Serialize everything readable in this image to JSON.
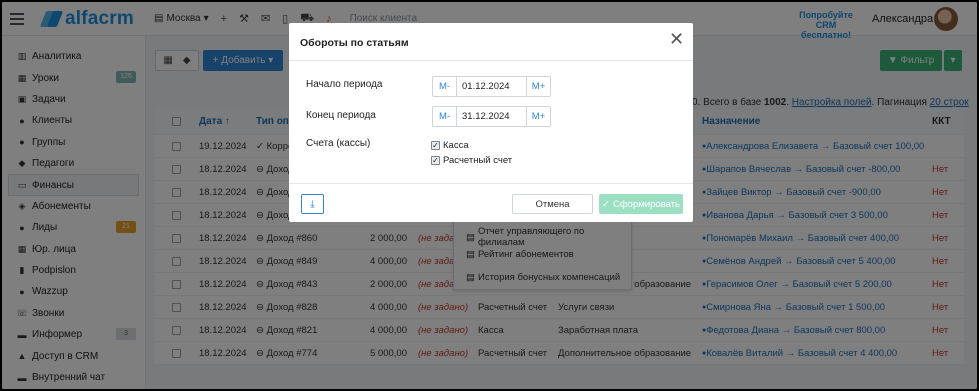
{
  "header": {
    "logo_text": "alfacrm",
    "branch": "Москва",
    "search_placeholder": "Поиск клиента",
    "promo_line1": "Попробуйте",
    "promo_line2": "CRM бесплатно!",
    "user_name": "Александра"
  },
  "sidebar": {
    "items": [
      {
        "label": "Аналитика",
        "icon": "chart-icon"
      },
      {
        "label": "Уроки",
        "icon": "calendar-icon",
        "badge": "126"
      },
      {
        "label": "Задачи",
        "icon": "tasks-icon"
      },
      {
        "label": "Клиенты",
        "icon": "user-icon"
      },
      {
        "label": "Группы",
        "icon": "users-icon"
      },
      {
        "label": "Педагоги",
        "icon": "graduation-cap-icon"
      },
      {
        "label": "Финансы",
        "icon": "money-icon"
      },
      {
        "label": "Абонементы",
        "icon": "tag-icon"
      },
      {
        "label": "Лиды",
        "icon": "user-plus-icon",
        "badge": "21"
      },
      {
        "label": "Юр. лица",
        "icon": "building-icon"
      },
      {
        "label": "Podpislon",
        "icon": "document-icon"
      },
      {
        "label": "Wazzup",
        "icon": "chat-icon"
      },
      {
        "label": "Звонки",
        "icon": "phone-icon"
      },
      {
        "label": "Информер",
        "icon": "monitor-icon",
        "badge": "3"
      },
      {
        "label": "Доступ в CRM",
        "icon": "lock-icon"
      },
      {
        "label": "Внутренний чат",
        "icon": "message-icon"
      }
    ]
  },
  "toolbar": {
    "add_label": "+ Добавить ▾",
    "filter_label": "▼ Фильтр",
    "filter_caret": "▾"
  },
  "pager": {
    "prefix": "0. Всего в базе ",
    "total": "1002",
    "settings_link": "Настройка полей",
    "pagination_label": "Пагинация",
    "pagination_value": "20 строк"
  },
  "table": {
    "headers": {
      "date": "Дата ↑",
      "type": "Тип опе",
      "purpose": "Назначение",
      "kkt": "ККТ"
    },
    "rows": [
      {
        "date": "19.12.2024",
        "type": "✓ Корре",
        "amount": "",
        "notset": "",
        "account": "",
        "article": "",
        "purpose": "Александрова Елизавета → Базовый счет 100,00",
        "kkt": ""
      },
      {
        "date": "18.12.2024",
        "type": "⊖ Доход",
        "amount": "",
        "notset": "",
        "account": "",
        "article": "",
        "purpose": "Шарапов Вячеслав → Базовый счет -800,00",
        "kkt": "Нет"
      },
      {
        "date": "18.12.2024",
        "type": "⊖ Доход",
        "amount": "",
        "notset": "",
        "account": "",
        "article": "",
        "purpose": "Зайцев Виктор → Базовый счет -900,00",
        "kkt": "Нет"
      },
      {
        "date": "18.12.2024",
        "type": "⊖ Доход",
        "amount": "",
        "notset": "",
        "account": "",
        "article": "",
        "purpose": "Иванова Дарья → Базовый счет 3 500,00",
        "kkt": "Нет"
      },
      {
        "date": "18.12.2024",
        "type": "⊖ Доход #860",
        "amount": "2 000,00",
        "notset": "(не задано)",
        "account": "",
        "article": "бразование",
        "purpose": "Пономарёв Михаил → Базовый счет 400,00",
        "kkt": "Нет"
      },
      {
        "date": "18.12.2024",
        "type": "⊖ Доход #849",
        "amount": "4 000,00",
        "notset": "(не задано)",
        "account": "",
        "article": "бразование",
        "purpose": "Семёнов Андрей → Базовый счет 5 400,00",
        "kkt": "Нет"
      },
      {
        "date": "18.12.2024",
        "type": "⊖ Доход #843",
        "amount": "2 000,00",
        "notset": "(не задано)",
        "account": "Расчетный счет",
        "article": "Дополнительное образование",
        "purpose": "Герасимов Олег → Базовый счет 5 200,00",
        "kkt": "Нет"
      },
      {
        "date": "18.12.2024",
        "type": "⊖ Доход #828",
        "amount": "4 000,00",
        "notset": "(не задано)",
        "account": "Расчетный счет",
        "article": "Услуги связи",
        "purpose": "Смирнова Яна → Базовый счет 1 500,00",
        "kkt": "Нет"
      },
      {
        "date": "18.12.2024",
        "type": "⊖ Доход #821",
        "amount": "4 000,00",
        "notset": "(не задано)",
        "account": "Касса",
        "article": "Заработная плата",
        "purpose": "Федотова Диана → Базовый счет 800,00",
        "kkt": "Нет"
      },
      {
        "date": "18.12.2024",
        "type": "⊖ Доход #774",
        "amount": "5 000,00",
        "notset": "(не задано)",
        "account": "Расчетный счет",
        "article": "Дополнительное образование",
        "purpose": "Ковалёв Виталий → Базовый счет 4 400,00",
        "kkt": "Нет"
      }
    ]
  },
  "dropdown": {
    "items": [
      "Отчет управляющего по филиалам",
      "Рейтинг абонементов",
      "История бонусных компенсаций"
    ]
  },
  "modal": {
    "title": "Обороты по статьям",
    "close": "✕",
    "start_label": "Начало периода",
    "end_label": "Конец периода",
    "accounts_label": "Счета (кассы)",
    "minus": "M-",
    "plus": "M+",
    "start_date": "01.12.2024",
    "end_date": "31.12.2024",
    "check_cash": "Касса",
    "check_account": "Расчетный счет",
    "cancel_label": "Отмена",
    "submit_label": "Сформировать"
  }
}
